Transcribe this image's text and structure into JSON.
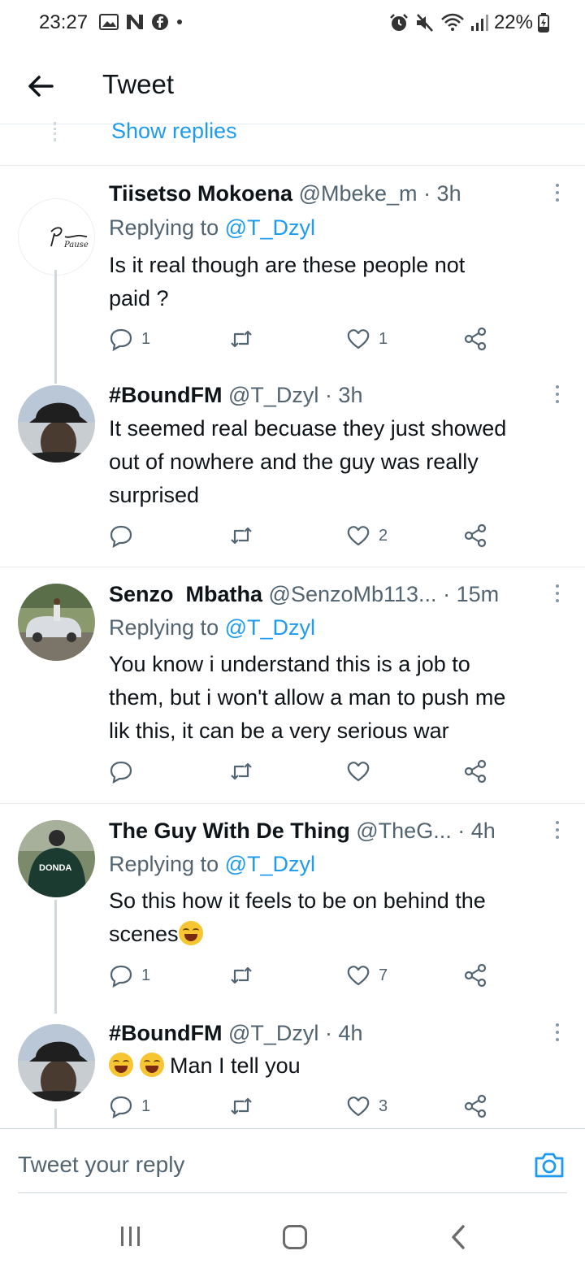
{
  "status_bar": {
    "time": "23:27",
    "battery": "22%"
  },
  "header": {
    "title": "Tweet"
  },
  "show_replies": "Show replies",
  "tweets": [
    {
      "name": "Tiisetso Mokoena",
      "handle": "@Mbeke_m",
      "time": "· 3h",
      "replying_prefix": "Replying to ",
      "replying_to": "@T_Dzyl",
      "lines": [
        "Is it real though are these people not",
        "paid ?"
      ],
      "reply_count": "1",
      "retweet_count": "",
      "like_count": "1",
      "avatar_text": "Pause"
    },
    {
      "name": "#BoundFM",
      "handle": "@T_Dzyl",
      "time": "· 3h",
      "lines": [
        "It seemed real becuase they just showed",
        "out of nowhere and the guy was really",
        "surprised"
      ],
      "reply_count": "",
      "retweet_count": "",
      "like_count": "2"
    },
    {
      "name": "Senzo  Mbatha",
      "handle": "@SenzoMb113...",
      "time": "· 15m",
      "replying_prefix": "Replying to ",
      "replying_to": "@T_Dzyl",
      "lines": [
        "You know i understand this is a job to",
        "them, but i won't allow a man to push me",
        "lik this, it can be a very serious war"
      ],
      "reply_count": "",
      "retweet_count": "",
      "like_count": ""
    },
    {
      "name": "The Guy With De Thing",
      "handle": "@TheG...",
      "time": "· 4h",
      "replying_prefix": "Replying to ",
      "replying_to": "@T_Dzyl",
      "lines": [
        "So this how it feels to be on behind the",
        "scenes"
      ],
      "reply_count": "1",
      "retweet_count": "",
      "like_count": "7",
      "avatar_text": "DONDA"
    },
    {
      "name": "#BoundFM",
      "handle": "@T_Dzyl",
      "time": "· 4h",
      "lines": [
        "Man I tell you"
      ],
      "reply_count": "1",
      "retweet_count": "",
      "like_count": "3"
    }
  ],
  "reply_bar": {
    "placeholder": "Tweet your reply"
  },
  "colors": {
    "accent": "#1d9bf0",
    "secondary_text": "#536471",
    "divider": "#e6ecf0"
  }
}
